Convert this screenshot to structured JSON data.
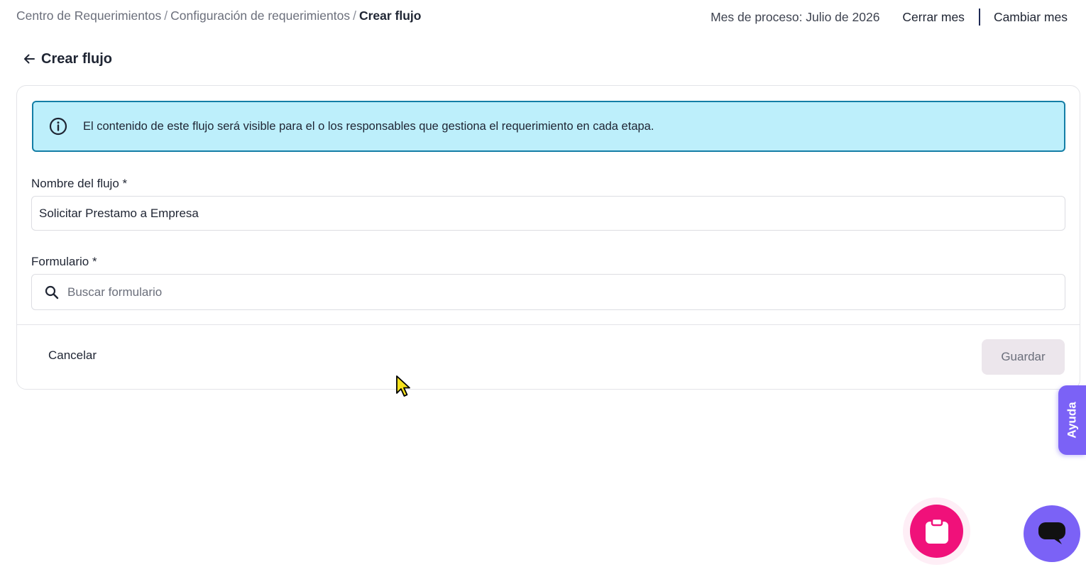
{
  "breadcrumb": {
    "items": [
      "Centro de Requerimientos",
      "Configuración de requerimientos"
    ],
    "current": "Crear flujo",
    "separator": "/"
  },
  "header_right": {
    "process_month": "Mes de proceso: Julio de 2026",
    "close_month": "Cerrar mes",
    "change_month": "Cambiar mes"
  },
  "page": {
    "title": "Crear flujo",
    "back_icon": "arrow-left-icon"
  },
  "alert": {
    "icon": "info-icon",
    "text": "El contenido de este flujo será visible para el o los responsables que gestiona el requerimiento en cada etapa."
  },
  "form": {
    "flow_name_label": "Nombre del flujo *",
    "flow_name_value": "Solicitar Prestamo a Empresa",
    "form_label": "Formulario *",
    "form_search_placeholder": "Buscar formulario",
    "form_search_value": ""
  },
  "actions": {
    "cancel": "Cancelar",
    "save": "Guardar",
    "save_disabled": true
  },
  "help_tab": {
    "label": "Ayuda"
  },
  "fabs": {
    "clipboard_icon": "clipboard-icon",
    "chat_icon": "chat-icon"
  },
  "colors": {
    "alert_bg": "#bdeffb",
    "alert_border": "#147ea6",
    "accent_purple": "#7b62f6",
    "accent_pink": "#f0117a",
    "save_disabled_bg": "#ece6ec"
  }
}
